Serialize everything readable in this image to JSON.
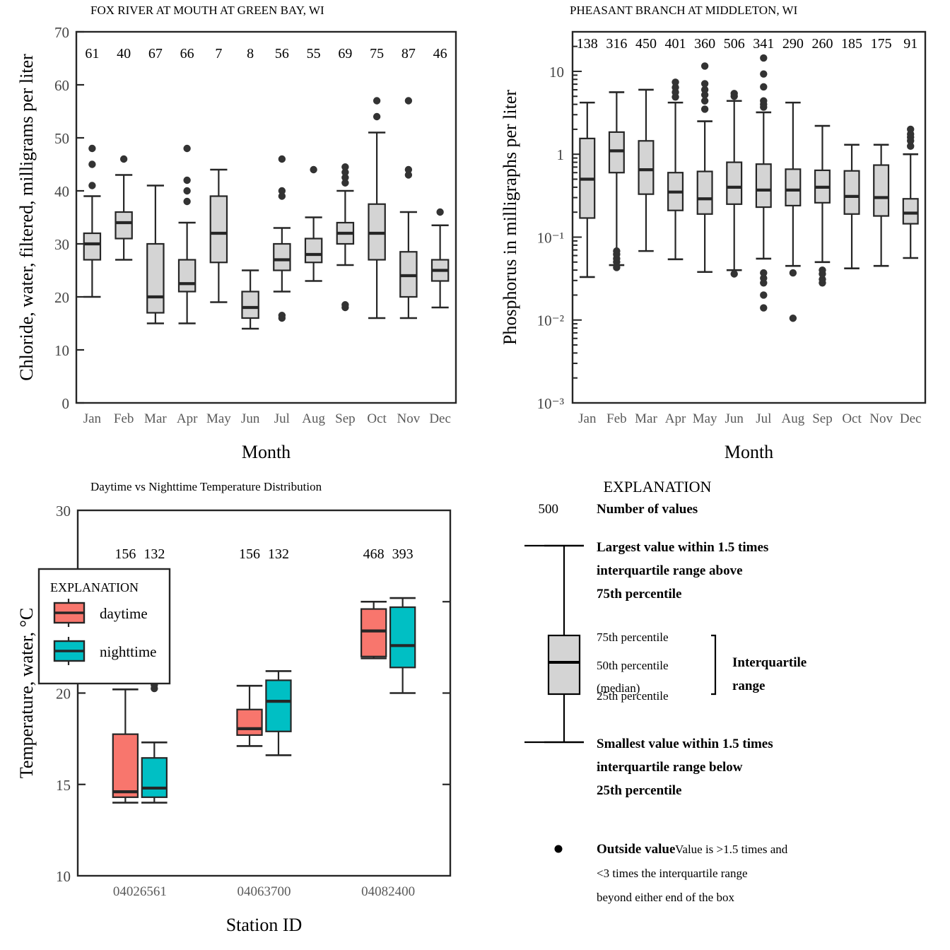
{
  "chart_data": [
    {
      "id": "fox-river",
      "type": "boxplot",
      "title": "FOX RIVER AT MOUTH AT GREEN BAY, WI",
      "xlabel": "Month",
      "ylabel": "Chloride, water, filtered, milligrams per liter",
      "yscale": "linear",
      "ylim": [
        0,
        70
      ],
      "yticks": [
        0,
        10,
        20,
        30,
        40,
        50,
        60,
        70
      ],
      "categories": [
        "Jan",
        "Feb",
        "Mar",
        "Apr",
        "May",
        "Jun",
        "Jul",
        "Aug",
        "Sep",
        "Oct",
        "Nov",
        "Dec"
      ],
      "counts": [
        61,
        40,
        67,
        66,
        7,
        8,
        56,
        55,
        69,
        75,
        87,
        46
      ],
      "boxes": [
        {
          "cat": "Jan",
          "lower_whisker": 20.0,
          "q1": 27.0,
          "median": 30.0,
          "q3": 32.0,
          "upper_whisker": 39.0,
          "outliers": [
            41.0,
            45.0,
            48.0
          ]
        },
        {
          "cat": "Feb",
          "lower_whisker": 27.0,
          "q1": 31.0,
          "median": 34.0,
          "q3": 36.0,
          "upper_whisker": 43.0,
          "outliers": [
            46.0
          ]
        },
        {
          "cat": "Mar",
          "lower_whisker": 15.0,
          "q1": 17.0,
          "median": 20.0,
          "q3": 30.0,
          "upper_whisker": 41.0,
          "outliers": []
        },
        {
          "cat": "Apr",
          "lower_whisker": 15.0,
          "q1": 21.0,
          "median": 22.5,
          "q3": 27.0,
          "upper_whisker": 34.0,
          "outliers": [
            38.0,
            40.0,
            42.0,
            48.0
          ]
        },
        {
          "cat": "May",
          "lower_whisker": 19.0,
          "q1": 26.5,
          "median": 32.0,
          "q3": 39.0,
          "upper_whisker": 44.0,
          "outliers": []
        },
        {
          "cat": "Jun",
          "lower_whisker": 14.0,
          "q1": 16.0,
          "median": 18.0,
          "q3": 21.0,
          "upper_whisker": 25.0,
          "outliers": []
        },
        {
          "cat": "Jul",
          "lower_whisker": 21.0,
          "q1": 25.0,
          "median": 27.0,
          "q3": 30.0,
          "upper_whisker": 33.0,
          "outliers": [
            16.0,
            16.5,
            39.0,
            40.0,
            46.0
          ]
        },
        {
          "cat": "Aug",
          "lower_whisker": 23.0,
          "q1": 26.5,
          "median": 28.0,
          "q3": 31.0,
          "upper_whisker": 35.0,
          "outliers": [
            44.0
          ]
        },
        {
          "cat": "Sep",
          "lower_whisker": 26.0,
          "q1": 30.0,
          "median": 32.0,
          "q3": 34.0,
          "upper_whisker": 40.0,
          "outliers": [
            18.0,
            18.5,
            41.5,
            42.5,
            43.5,
            44.5
          ]
        },
        {
          "cat": "Oct",
          "lower_whisker": 16.0,
          "q1": 27.0,
          "median": 32.0,
          "q3": 37.5,
          "upper_whisker": 51.0,
          "outliers": [
            54.0,
            57.0
          ]
        },
        {
          "cat": "Nov",
          "lower_whisker": 16.0,
          "q1": 20.0,
          "median": 24.0,
          "q3": 28.5,
          "upper_whisker": 36.0,
          "outliers": [
            43.0,
            44.0,
            57.0
          ]
        },
        {
          "cat": "Dec",
          "lower_whisker": 18.0,
          "q1": 23.0,
          "median": 25.0,
          "q3": 27.0,
          "upper_whisker": 33.5,
          "outliers": [
            36.0
          ]
        }
      ]
    },
    {
      "id": "pheasant-branch",
      "type": "boxplot",
      "title": "PHEASANT BRANCH AT MIDDLETON, WI",
      "xlabel": "Month",
      "ylabel": "Phosphorus in milligraphs per liter",
      "yscale": "log",
      "ylim": [
        0.001,
        30
      ],
      "yticks": [
        10,
        1,
        0.1,
        0.01,
        0.001
      ],
      "yticklabels": [
        "10",
        "1",
        "10⁻¹",
        "10⁻²",
        "10⁻³"
      ],
      "categories": [
        "Jan",
        "Feb",
        "Mar",
        "Apr",
        "May",
        "Jun",
        "Jul",
        "Aug",
        "Sep",
        "Oct",
        "Nov",
        "Dec"
      ],
      "counts": [
        138,
        316,
        450,
        401,
        360,
        506,
        341,
        290,
        260,
        185,
        175,
        91
      ],
      "boxes": [
        {
          "cat": "Jan",
          "lower_whisker": 0.033,
          "q1": 0.17,
          "median": 0.5,
          "q3": 1.55,
          "upper_whisker": 4.2,
          "outliers": []
        },
        {
          "cat": "Feb",
          "lower_whisker": 0.046,
          "q1": 0.6,
          "median": 1.1,
          "q3": 1.85,
          "upper_whisker": 5.6,
          "outliers": [
            0.043,
            0.05,
            0.055,
            0.062,
            0.068
          ]
        },
        {
          "cat": "Mar",
          "lower_whisker": 0.068,
          "q1": 0.33,
          "median": 0.65,
          "q3": 1.45,
          "upper_whisker": 6.0,
          "outliers": []
        },
        {
          "cat": "Apr",
          "lower_whisker": 0.054,
          "q1": 0.21,
          "median": 0.35,
          "q3": 0.6,
          "upper_whisker": 4.2,
          "outliers": [
            4.9,
            5.6,
            6.4,
            7.4
          ]
        },
        {
          "cat": "May",
          "lower_whisker": 0.038,
          "q1": 0.19,
          "median": 0.29,
          "q3": 0.62,
          "upper_whisker": 2.5,
          "outliers": [
            3.5,
            4.4,
            5.2,
            6.0,
            7.1,
            11.6
          ]
        },
        {
          "cat": "Jun",
          "lower_whisker": 0.04,
          "q1": 0.25,
          "median": 0.4,
          "q3": 0.8,
          "upper_whisker": 4.4,
          "outliers": [
            0.036,
            5.0,
            5.4
          ]
        },
        {
          "cat": "Jul",
          "lower_whisker": 0.055,
          "q1": 0.23,
          "median": 0.37,
          "q3": 0.76,
          "upper_whisker": 3.2,
          "outliers": [
            0.014,
            0.02,
            0.028,
            0.032,
            0.037,
            3.7,
            4.0,
            4.4,
            6.5,
            9.3,
            14.5
          ]
        },
        {
          "cat": "Aug",
          "lower_whisker": 0.045,
          "q1": 0.24,
          "median": 0.37,
          "q3": 0.66,
          "upper_whisker": 4.2,
          "outliers": [
            0.0105,
            0.037
          ]
        },
        {
          "cat": "Sep",
          "lower_whisker": 0.05,
          "q1": 0.26,
          "median": 0.4,
          "q3": 0.64,
          "upper_whisker": 2.2,
          "outliers": [
            0.028,
            0.031,
            0.036,
            0.04
          ]
        },
        {
          "cat": "Oct",
          "lower_whisker": 0.042,
          "q1": 0.19,
          "median": 0.31,
          "q3": 0.63,
          "upper_whisker": 1.3,
          "outliers": []
        },
        {
          "cat": "Nov",
          "lower_whisker": 0.045,
          "q1": 0.18,
          "median": 0.3,
          "q3": 0.74,
          "upper_whisker": 1.3,
          "outliers": []
        },
        {
          "cat": "Dec",
          "lower_whisker": 0.056,
          "q1": 0.145,
          "median": 0.195,
          "q3": 0.29,
          "upper_whisker": 1.0,
          "outliers": [
            1.25,
            1.45,
            1.6,
            1.75,
            2.0
          ]
        }
      ]
    },
    {
      "id": "temperature",
      "type": "boxplot",
      "title": "Daytime vs Nighttime Temperature Distribution",
      "xlabel": "Station ID",
      "ylabel": "Temperature, water, °C",
      "yscale": "linear",
      "ylim": [
        10,
        30
      ],
      "yticks": [
        10,
        15,
        20,
        25,
        30
      ],
      "categories": [
        "04026561",
        "04063700",
        "04082400"
      ],
      "legend": {
        "title": "EXPLANATION",
        "position": "inside-left",
        "entries": [
          {
            "label": "daytime",
            "color": "#F8766D"
          },
          {
            "label": "nighttime",
            "color": "#00BFC4"
          }
        ]
      },
      "series": [
        {
          "name": "daytime",
          "color": "#F8766D",
          "counts": [
            156,
            156,
            468
          ],
          "boxes": [
            {
              "cat": "04026561",
              "lower_whisker": 14.0,
              "q1": 14.3,
              "median": 14.6,
              "q3": 17.75,
              "upper_whisker": 20.2,
              "outliers": []
            },
            {
              "cat": "04063700",
              "lower_whisker": 17.1,
              "q1": 17.7,
              "median": 18.05,
              "q3": 19.1,
              "upper_whisker": 20.4,
              "outliers": []
            },
            {
              "cat": "04082400",
              "lower_whisker": 21.9,
              "q1": 22.0,
              "median": 23.4,
              "q3": 24.6,
              "upper_whisker": 25.0,
              "outliers": []
            }
          ]
        },
        {
          "name": "nighttime",
          "color": "#00BFC4",
          "counts": [
            132,
            132,
            393
          ],
          "boxes": [
            {
              "cat": "04026561",
              "lower_whisker": 14.0,
              "q1": 14.3,
              "median": 14.8,
              "q3": 16.45,
              "upper_whisker": 17.3,
              "outliers": [
                20.25,
                20.45
              ]
            },
            {
              "cat": "04063700",
              "lower_whisker": 16.6,
              "q1": 17.9,
              "median": 19.55,
              "q3": 20.7,
              "upper_whisker": 21.2,
              "outliers": []
            },
            {
              "cat": "04082400",
              "lower_whisker": 20.0,
              "q1": 21.4,
              "median": 22.6,
              "q3": 24.7,
              "upper_whisker": 25.2,
              "outliers": []
            }
          ]
        }
      ]
    }
  ],
  "explanation": {
    "title": "EXPLANATION",
    "number_of_values_example": "500",
    "number_of_values_label": "Number of values",
    "upper_whisker_lines": [
      "Largest value within 1.5 times",
      "interquartile range above",
      "75th percentile"
    ],
    "p75_label": "75th percentile",
    "median_label_line1": "50th percentile",
    "median_label_line2": "(median)",
    "p25_label": "25th percentile",
    "iqr_label_line1": "Interquartile",
    "iqr_label_line2": "range",
    "lower_whisker_lines": [
      "Smallest value within 1.5 times",
      "interquartile range below",
      "25th percentile"
    ],
    "outside_value_label": "Outside value",
    "outside_value_lines": [
      "Value is >1.5 times and",
      "<3 times the interquartile range",
      "beyond either end of the box"
    ]
  },
  "colors": {
    "box_fill": "#d4d4d4",
    "line": "#262626",
    "daytime": "#F8766D",
    "nighttime": "#00BFC4",
    "tick_text": "#4a4a4a"
  }
}
